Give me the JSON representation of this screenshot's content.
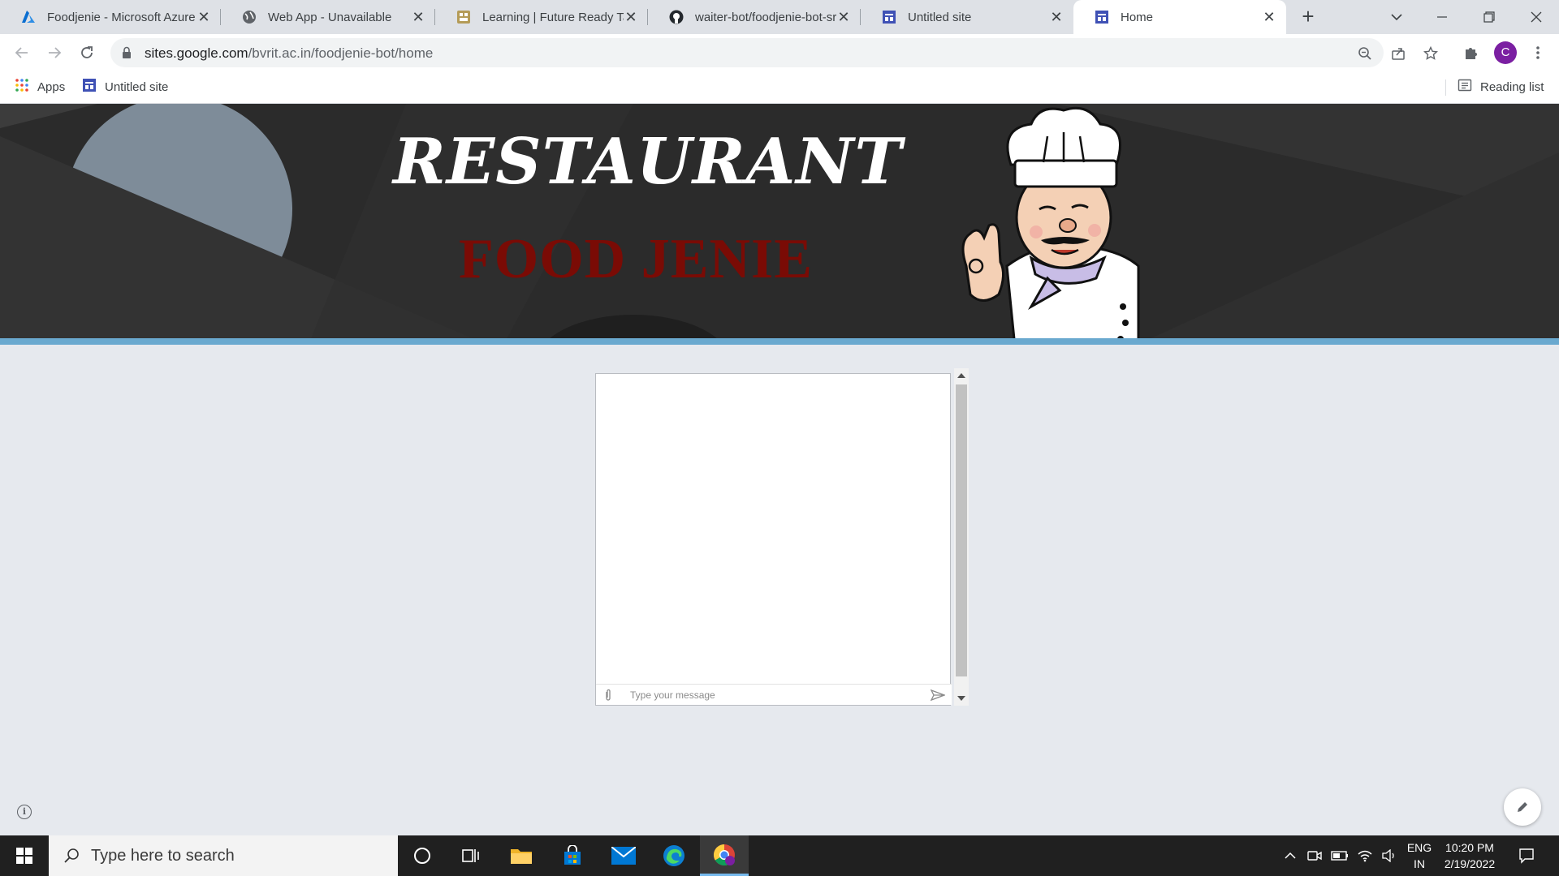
{
  "browser": {
    "tabs": [
      {
        "title": "Foodjenie - Microsoft Azure",
        "icon": "azure-icon"
      },
      {
        "title": "Web App - Unavailable",
        "icon": "globe-icon"
      },
      {
        "title": "Learning | Future Ready Talent",
        "icon": "learning-icon"
      },
      {
        "title": "waiter-bot/foodjenie-bot-src",
        "icon": "github-icon"
      },
      {
        "title": "Untitled site",
        "icon": "google-sites-icon"
      },
      {
        "title": "Home",
        "icon": "google-sites-icon",
        "active": true
      }
    ],
    "address_bar": {
      "host": "sites.google.com",
      "path": "/bvrit.ac.in/foodjenie-bot/home"
    },
    "profile_initial": "C",
    "bookmarks": [
      {
        "label": "Apps",
        "icon": "apps-grid-icon"
      },
      {
        "label": "Untitled site",
        "icon": "google-sites-icon"
      }
    ],
    "reading_list_label": "Reading list"
  },
  "site": {
    "heading": "RESTAURANT",
    "subheading": "FOOD JENIE",
    "colors": {
      "banner_bg": "#2b2b2b",
      "accent_strip": "#6aa9cf",
      "subheading": "#7a0b05",
      "page_bg": "#e6e9ee"
    },
    "chat": {
      "input_placeholder": "Type your message"
    }
  },
  "taskbar": {
    "search_placeholder": "Type here to search",
    "language": "ENG",
    "region": "IN",
    "time": "10:20 PM",
    "date": "2/19/2022"
  }
}
